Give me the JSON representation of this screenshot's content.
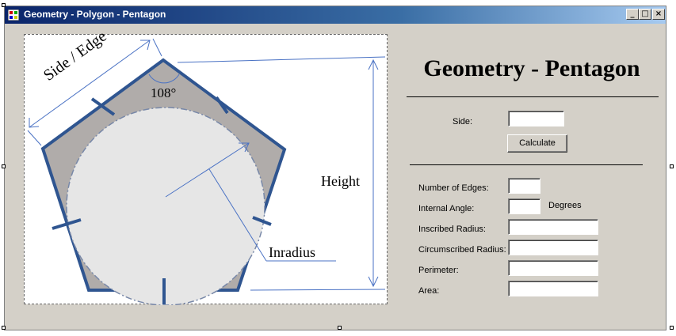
{
  "window": {
    "title": "Geometry - Polygon - Pentagon",
    "minimize_glyph": "_",
    "maximize_glyph": "□",
    "close_glyph": "×"
  },
  "diagram": {
    "side_label": "Side / Edge",
    "angle_label": "108°",
    "height_label": "Height",
    "inradius_label": "Inradius"
  },
  "form": {
    "title": "Geometry - Pentagon",
    "side_label": "Side:",
    "side_value": "",
    "calculate_label": "Calculate",
    "edges_label": "Number of Edges:",
    "edges_value": "",
    "angle_label": "Internal Angle:",
    "angle_value": "",
    "angle_unit": "Degrees",
    "inscribed_label": "Inscribed Radius:",
    "inscribed_value": "",
    "circumscribed_label": "Circumscribed Radius:",
    "circumscribed_value": "",
    "perimeter_label": "Perimeter:",
    "perimeter_value": "",
    "area_label": "Area:",
    "area_value": ""
  },
  "colors": {
    "title_gradient_start": "#0a246a",
    "title_gradient_end": "#a6caf0",
    "window_face": "#d4d0c8",
    "pentagon_fill": "#b0acaa",
    "pentagon_stroke": "#2f5590",
    "circle_fill": "#e6e6e6",
    "dimension_line": "#4a72c4"
  },
  "icons": [
    "app-icon",
    "minimize-icon",
    "maximize-icon",
    "close-icon"
  ]
}
